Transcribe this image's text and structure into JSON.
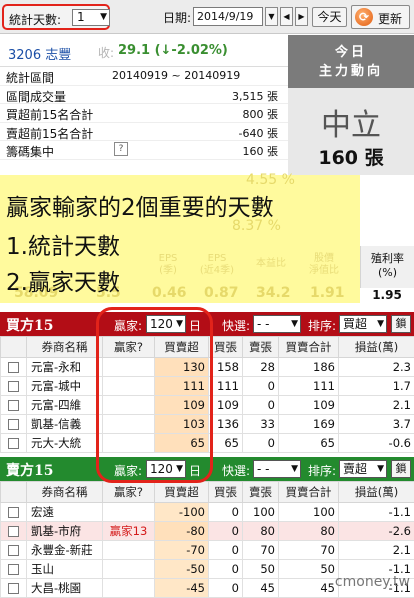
{
  "toolbar": {
    "days_label": "統計天數:",
    "days_value": "1",
    "date_label": "日期:",
    "date_value": "2014/9/19",
    "today_label": "今天",
    "refresh_label": "更新"
  },
  "stock": {
    "code_name": "3206 志豐",
    "close_label": "收:",
    "close_value": "29.1 (↓-2.02%)"
  },
  "info": [
    {
      "label": "統計區間",
      "value": "20140919 ~ 20140919"
    },
    {
      "label": "區間成交量",
      "value": "3,515 張"
    },
    {
      "label": "買超前15名合計",
      "value": "800 張"
    },
    {
      "label": "賣超前15名合計",
      "value": "-640 張"
    },
    {
      "label": "籌碼集中",
      "value": "160 張",
      "help": "?"
    }
  ],
  "force": {
    "title_1": "今日",
    "title_2": "主力動向",
    "status": "中立",
    "count": "160 張"
  },
  "overlay": {
    "line1": "贏家輸家的2個重要的天數",
    "line2": "1.統計天數",
    "line3": "2.贏家天數",
    "ghost_a": "4.55 %",
    "ghost_b": "8.37 %",
    "ghost_headers": [
      "EPS\n(季)",
      "EPS\n(近4季)",
      "本益比",
      "股價\n淨值比"
    ],
    "ghost_values": [
      "58.09",
      "5.5",
      "0.46",
      "0.87",
      "34.2",
      "1.91"
    ]
  },
  "yield": {
    "label_1": "殖利率",
    "label_2": "(%)",
    "value": "1.95"
  },
  "buy": {
    "title": "買方15",
    "winner_label": "贏家:",
    "winner_days": "120",
    "unit": "日",
    "quick_label": "快選:",
    "quick_value": "- -",
    "sort_label": "排序:",
    "sort_value": "買超",
    "lock_label": "鎖",
    "headers": [
      "",
      "券商名稱",
      "贏家?",
      "買賣超",
      "買張",
      "賣張",
      "買賣合計",
      "損益(萬)"
    ],
    "rows": [
      {
        "name": "元富-永和",
        "winner": "",
        "net": "130",
        "buy": "158",
        "sell": "28",
        "total": "186",
        "pl": "2.3"
      },
      {
        "name": "元富-城中",
        "winner": "",
        "net": "111",
        "buy": "111",
        "sell": "0",
        "total": "111",
        "pl": "1.7"
      },
      {
        "name": "元富-四維",
        "winner": "",
        "net": "109",
        "buy": "109",
        "sell": "0",
        "total": "109",
        "pl": "2.1"
      },
      {
        "name": "凱基-信義",
        "winner": "",
        "net": "103",
        "buy": "136",
        "sell": "33",
        "total": "169",
        "pl": "3.7"
      },
      {
        "name": "元大-大統",
        "winner": "",
        "net": "65",
        "buy": "65",
        "sell": "0",
        "total": "65",
        "pl": "-0.6"
      }
    ]
  },
  "sell": {
    "title": "賣方15",
    "winner_label": "贏家:",
    "winner_days": "120",
    "unit": "日",
    "quick_label": "快選:",
    "quick_value": "- -",
    "sort_label": "排序:",
    "sort_value": "賣超",
    "lock_label": "鎖",
    "headers": [
      "",
      "券商名稱",
      "贏家?",
      "買賣超",
      "買張",
      "賣張",
      "買賣合計",
      "損益(萬)"
    ],
    "rows": [
      {
        "name": "宏遠",
        "winner": "",
        "net": "-100",
        "buy": "0",
        "sell": "100",
        "total": "100",
        "pl": "-1.1",
        "hl": false
      },
      {
        "name": "凱基-市府",
        "winner": "贏家13",
        "net": "-80",
        "buy": "0",
        "sell": "80",
        "total": "80",
        "pl": "-2.6",
        "hl": true
      },
      {
        "name": "永豐金-新莊",
        "winner": "",
        "net": "-70",
        "buy": "0",
        "sell": "70",
        "total": "70",
        "pl": "2.1",
        "hl": false
      },
      {
        "name": "玉山",
        "winner": "",
        "net": "-50",
        "buy": "0",
        "sell": "50",
        "total": "50",
        "pl": "-1.1",
        "hl": false
      },
      {
        "name": "大昌-桃園",
        "winner": "",
        "net": "-45",
        "buy": "0",
        "sell": "45",
        "total": "45",
        "pl": "-1.1",
        "hl": false
      }
    ]
  },
  "watermark": "cmoney.tw",
  "colors": {
    "buy_bar": "#b30d16",
    "sell_bar": "#238a2e",
    "highlight": "#e2231a"
  }
}
